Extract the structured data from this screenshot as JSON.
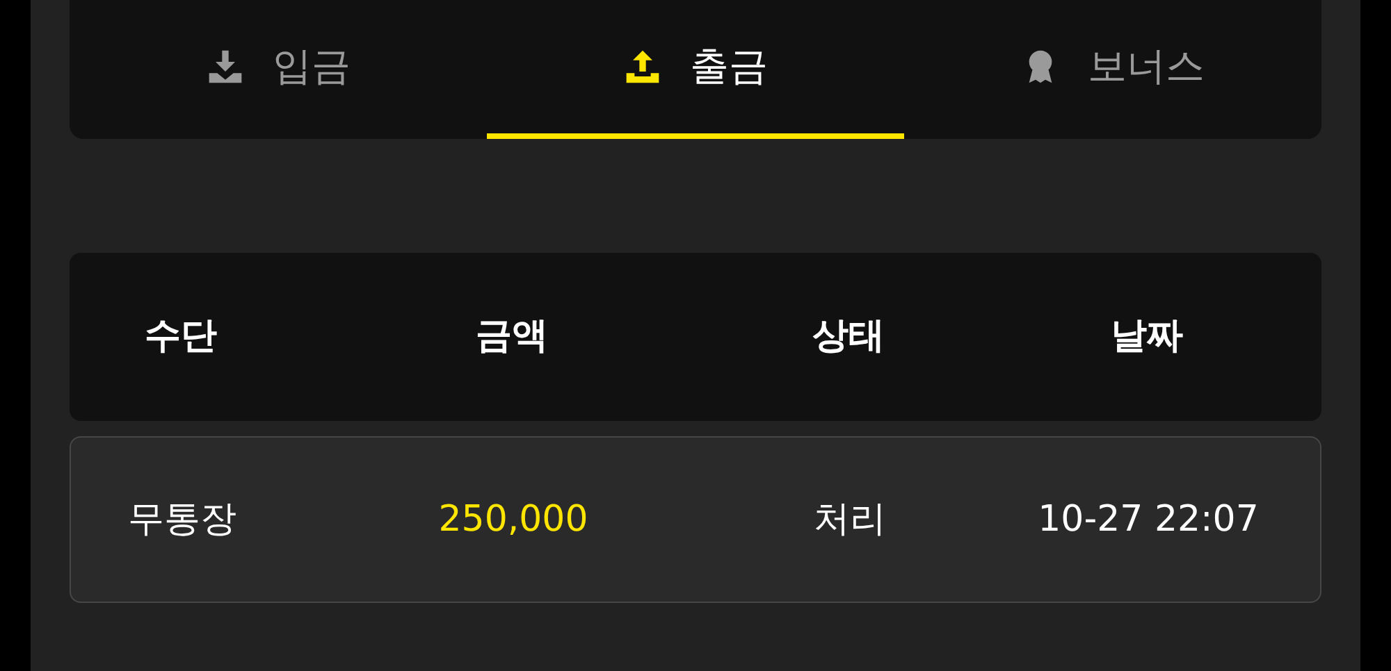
{
  "tabs": [
    {
      "label": "입금",
      "kind": "deposit",
      "selected": false
    },
    {
      "label": "출금",
      "kind": "withdrawal",
      "selected": true
    },
    {
      "label": "보너스",
      "kind": "bonus",
      "selected": false
    }
  ],
  "table": {
    "columns": [
      "수단",
      "금액",
      "상태",
      "날짜"
    ],
    "rows": [
      {
        "cells": [
          "무통장",
          "250,000",
          "처리",
          "10-27 22:07"
        ]
      }
    ]
  }
}
